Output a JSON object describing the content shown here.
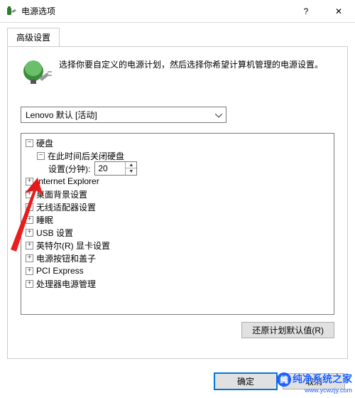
{
  "window": {
    "title": "电源选项",
    "help_icon": "?",
    "close_icon": "✕"
  },
  "tab": {
    "label": "高级设置"
  },
  "description": "选择你要自定义的电源计划，然后选择你希望计算机管理的电源设置。",
  "plan_select": {
    "value": "Lenovo 默认 [活动]"
  },
  "tree": {
    "hard_disk": {
      "label": "硬盘",
      "sub_label": "在此时间后关闭硬盘",
      "setting_label": "设置(分钟):",
      "setting_value": "20"
    },
    "items": [
      "Internet Explorer",
      "桌面背景设置",
      "无线适配器设置",
      "睡眠",
      "USB 设置",
      "英特尔(R) 显卡设置",
      "电源按钮和盖子",
      "PCI Express",
      "处理器电源管理"
    ]
  },
  "buttons": {
    "restore": "还原计划默认值(R)",
    "ok": "确定",
    "cancel": "取消"
  },
  "watermark": {
    "circle": "纯",
    "text": "纯净系统之家",
    "url": "www.ycwzjy.com"
  }
}
